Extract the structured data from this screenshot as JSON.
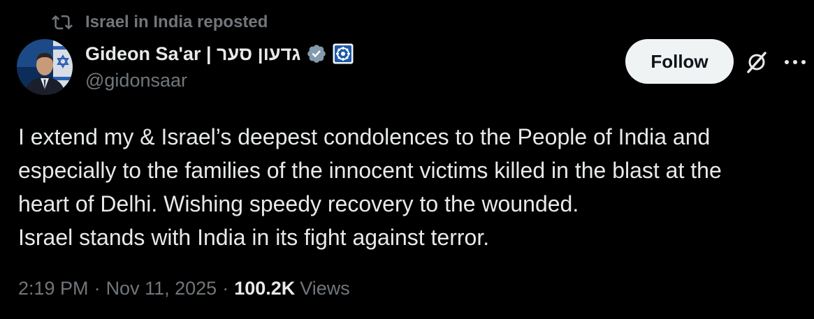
{
  "repost": {
    "icon": "repost-icon",
    "label": "Israel in India reposted"
  },
  "author": {
    "display_name": "Gideon Sa'ar | גדעון סער",
    "handle": "@gidonsaar",
    "verified_icon": "verified-badge-icon",
    "affiliate_icon": "affiliate-emblem-icon",
    "avatar": "profile-avatar"
  },
  "actions": {
    "follow_label": "Follow",
    "grok_icon": "grok-icon",
    "more_icon": "more-icon"
  },
  "tweet": {
    "lines": [
      "I extend my & Israel’s deepest condolences to the People of India and",
      "especially to the families of the innocent victims killed in the blast at the",
      "heart of Delhi. Wishing speedy recovery to the wounded.",
      "Israel stands with India in its fight against terror."
    ]
  },
  "meta": {
    "time": "2:19 PM",
    "separator": "·",
    "date": "Nov 11, 2025",
    "views_count": "100.2K",
    "views_label": "Views"
  },
  "colors": {
    "background": "#000000",
    "primary_text": "#e7e9ea",
    "secondary_text": "#71767b",
    "follow_bg": "#eff3f4",
    "verified_badge": "#829aab",
    "affiliate_blue": "#1d5aa8"
  }
}
